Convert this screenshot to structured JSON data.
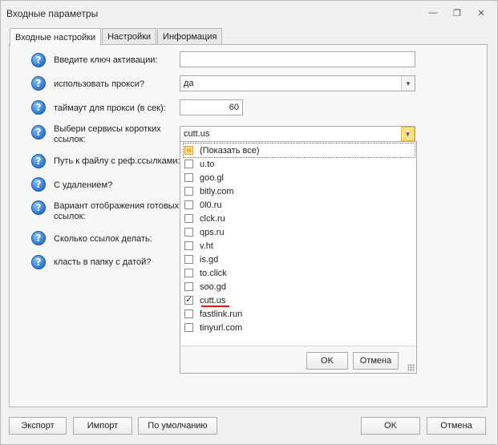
{
  "window": {
    "title": "Входные параметры",
    "controls": {
      "minimize_icon": "—",
      "restore_icon": "❐",
      "close_icon": "✕"
    }
  },
  "tabs": [
    {
      "label": "Входные настройки",
      "active": true
    },
    {
      "label": "Настройки",
      "active": false
    },
    {
      "label": "Информация",
      "active": false
    }
  ],
  "settings": [
    {
      "label": "Введите ключ активации:",
      "icon": "help-icon"
    },
    {
      "label": "использовать прокси?",
      "icon": "help-icon"
    },
    {
      "label": "таймаут для прокси (в сек):",
      "icon": "help-icon"
    },
    {
      "label": "Выбери сервисы коротких ссылок:",
      "icon": "help-icon"
    },
    {
      "label": "Путь к файлу с реф.ссылками:",
      "icon": "help-icon"
    },
    {
      "label": "С удалением?",
      "icon": "help-icon"
    },
    {
      "label": "Вариант отображения готовых ссылок:",
      "icon": "help-icon"
    },
    {
      "label": "Сколько ссылок делать:",
      "icon": "help-icon"
    },
    {
      "label": "класть в  папку с датой?",
      "icon": "help-icon"
    }
  ],
  "fields": {
    "activation_key": "",
    "use_proxy": "да",
    "proxy_timeout": "60",
    "short_services": "cutt.us"
  },
  "dropdown": {
    "items": [
      {
        "label": "(Показать все)",
        "state": "partial"
      },
      {
        "label": "u.to",
        "state": "unchecked"
      },
      {
        "label": "goo.gl",
        "state": "unchecked"
      },
      {
        "label": "bitly.com",
        "state": "unchecked"
      },
      {
        "label": "0l0.ru",
        "state": "unchecked"
      },
      {
        "label": "clck.ru",
        "state": "unchecked"
      },
      {
        "label": "qps.ru",
        "state": "unchecked"
      },
      {
        "label": "v.ht",
        "state": "unchecked"
      },
      {
        "label": "is.gd",
        "state": "unchecked"
      },
      {
        "label": "to.click",
        "state": "unchecked"
      },
      {
        "label": "soo.gd",
        "state": "unchecked"
      },
      {
        "label": "cutt.us",
        "state": "checked"
      },
      {
        "label": "fastlink.run",
        "state": "unchecked"
      },
      {
        "label": "tinyurl.com",
        "state": "unchecked"
      }
    ],
    "ok_label": "OK",
    "cancel_label": "Отмена"
  },
  "footer": {
    "export_label": "Экспорт",
    "import_label": "Импорт",
    "defaults_label": "По умолчанию",
    "ok_label": "OK",
    "cancel_label": "Отмена"
  },
  "colors": {
    "accent_yellow": "#fde28a",
    "help_icon_blue": "#2e78cc",
    "underline_red": "#d02020"
  }
}
